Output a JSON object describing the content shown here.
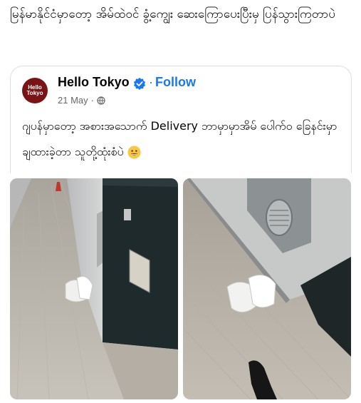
{
  "share_caption": "မြန်မာနိုင်ငံမှာတော့ အိမ်ထဲဝင် ခွံ့ကျွေး ဆေးကြောပေးပြီးမှ ပြန်သွားကြတာပဲ",
  "post": {
    "avatar_line1": "Hello",
    "avatar_line2": "Tokyo",
    "page_name": "Hello Tokyo",
    "dot": "·",
    "follow_label": "Follow",
    "date": "21 May",
    "date_sep": "·",
    "text": "ဂျပန်မှာတော့ အစားအသောက် Delivery ဘာမှာမှာအိမ် ပေါက်ဝ ခြေနင်းမှာချထားခဲ့တာ သူတို့ထုံးစံပဲ"
  },
  "colors": {
    "accent": "#1877f2",
    "secondary_text": "#65676b",
    "avatar_bg": "#7a1313",
    "emoji": "#f7c844"
  },
  "icons": [
    "verified-badge-icon",
    "globe-icon",
    "grinning-face-emoji"
  ]
}
